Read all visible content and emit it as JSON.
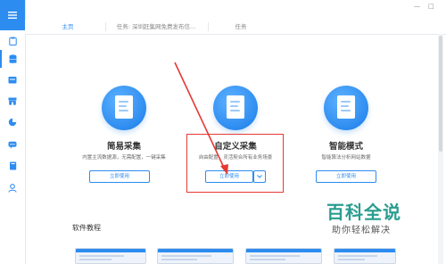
{
  "window": {
    "controls": {
      "minimize": "—",
      "maximize": "□"
    }
  },
  "sidebar": {
    "menu_icon": "menu-icon",
    "items": [
      {
        "icon": "clipboard-icon",
        "active": false
      },
      {
        "icon": "database-icon",
        "active": true
      },
      {
        "icon": "inbox-icon",
        "active": false
      },
      {
        "icon": "store-icon",
        "active": false
      },
      {
        "icon": "pie-chart-icon",
        "active": false
      },
      {
        "icon": "chat-icon",
        "active": false
      },
      {
        "icon": "book-icon",
        "active": false
      },
      {
        "icon": "user-icon",
        "active": false
      }
    ]
  },
  "tabs": [
    {
      "label": "主页",
      "active": true
    },
    {
      "label": "任务: 深圳赶集网免费发布信...",
      "active": false
    },
    {
      "label": "任务",
      "active": false
    }
  ],
  "cards": [
    {
      "title": "简易采集",
      "desc": "内置主流数据源，无需配置，一键采集",
      "button": "立即使用"
    },
    {
      "title": "自定义采集",
      "desc": "自由配置，灵活契合所有业务场景",
      "button": "立即使用",
      "dropdown_icon": "chevron-down-icon"
    },
    {
      "title": "智能模式",
      "desc": "智能算法分析网站数据",
      "button": "立即使用"
    }
  ],
  "tutorial": {
    "title": "软件教程"
  },
  "watermark": {
    "big": "百科全说",
    "small": "助你轻松解决"
  },
  "colors": {
    "accent": "#2d8cf0",
    "highlight": "#e53935",
    "watermark": "#2a9d8f"
  }
}
